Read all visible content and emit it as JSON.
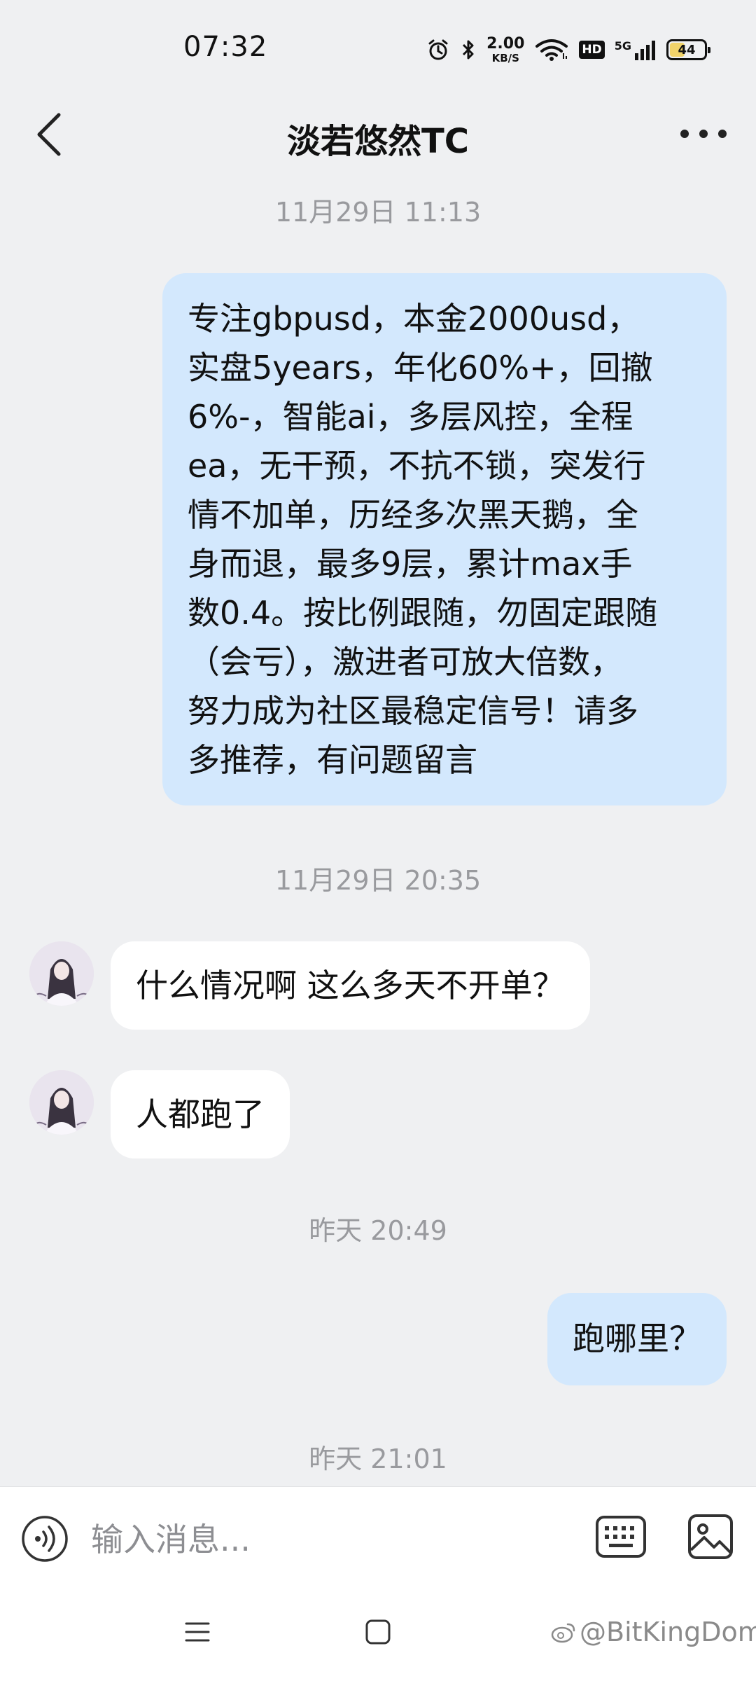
{
  "status_bar": {
    "time": "07:32",
    "net_speed_value": "2.00",
    "net_speed_unit": "KB/S",
    "hd_label": "HD",
    "network_label": "5G",
    "battery_level": "44"
  },
  "header": {
    "title": "淡若悠然TC"
  },
  "messages": [
    {
      "type": "timestamp",
      "text": "11月29日 11:13"
    },
    {
      "type": "outgoing",
      "lines": [
        "专注gbpusd，本金2000usd，",
        "实盘5years，年化60%+，回撤",
        "6%-，智能ai，多层风控，全程",
        "ea，无干预，不抗不锁，突发行",
        "情不加单，历经多次黑天鹅，全",
        "身而退，最多9层，累计max手",
        "数0.4。按比例跟随，勿固定跟随",
        "（会亏），激进者可放大倍数，",
        "努力成为社区最稳定信号！请多",
        "多推荐，有问题留言"
      ]
    },
    {
      "type": "timestamp",
      "text": "11月29日 20:35"
    },
    {
      "type": "incoming",
      "text": "什么情况啊 这么多天不开单？"
    },
    {
      "type": "incoming",
      "text": "人都跑了"
    },
    {
      "type": "timestamp",
      "text": "昨天 20:49"
    },
    {
      "type": "outgoing",
      "text": "跑哪里？"
    },
    {
      "type": "timestamp",
      "text": "昨天 21:01"
    }
  ],
  "input_bar": {
    "placeholder": "输入消息..."
  },
  "watermark": {
    "text": "@BitKingDom"
  },
  "colors": {
    "background": "#eff0f2",
    "outgoing_bubble": "#d3e8fd",
    "incoming_bubble": "#ffffff",
    "timestamp_text": "#999a9e"
  }
}
